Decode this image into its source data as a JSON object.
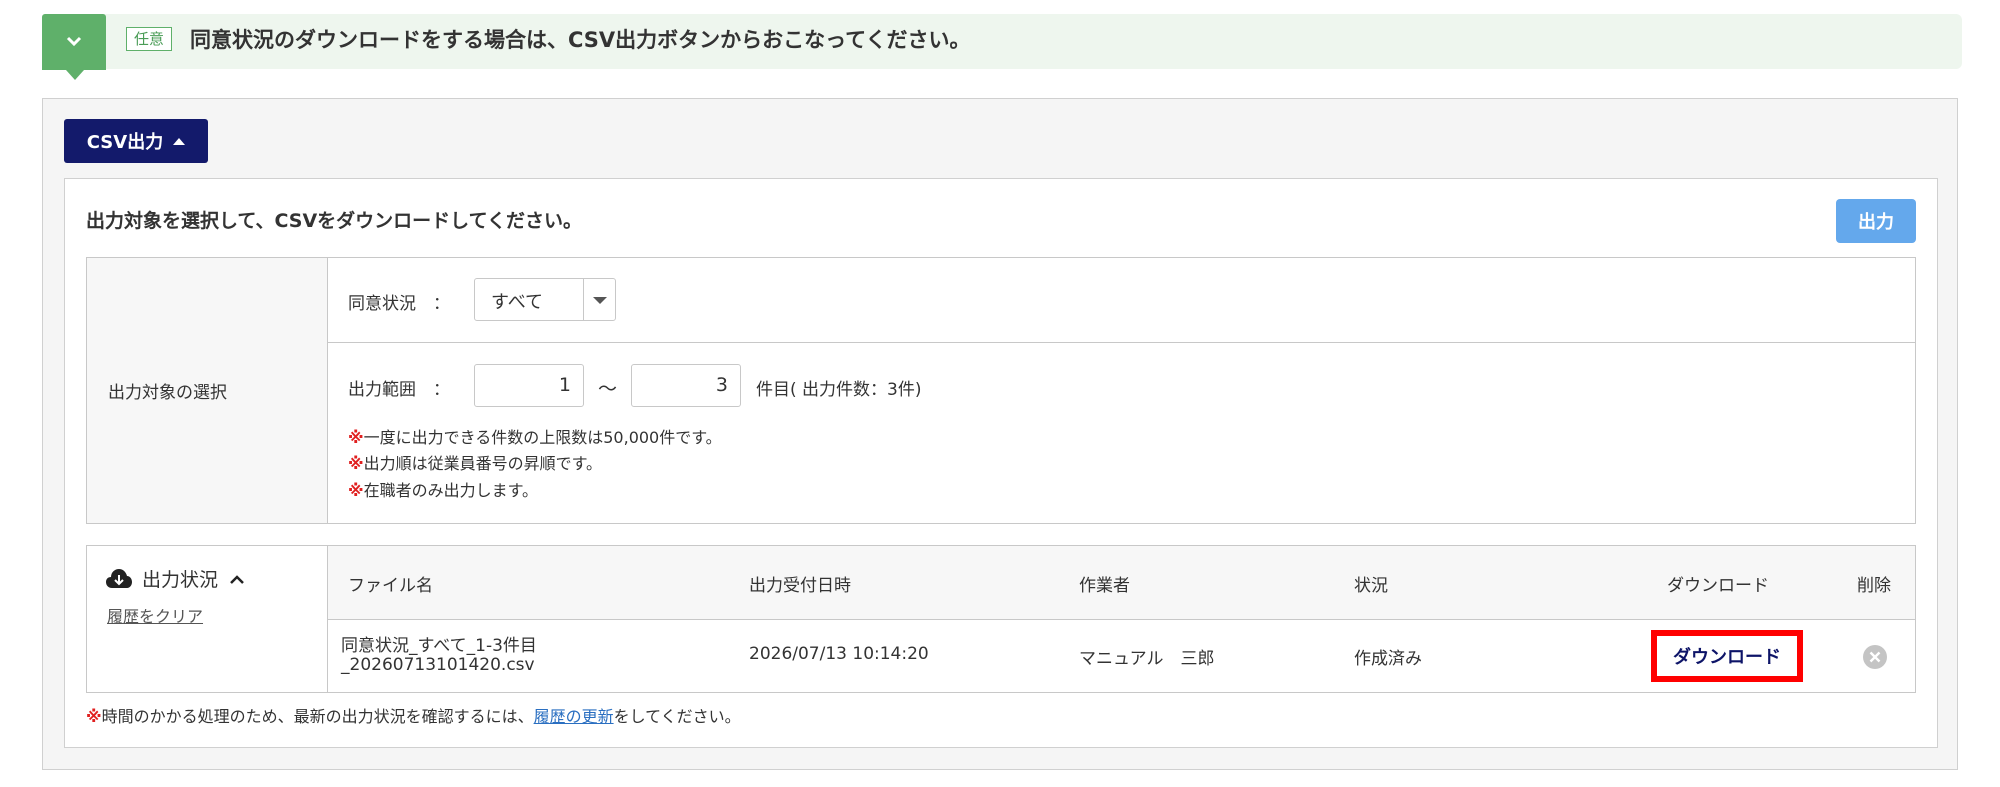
{
  "banner": {
    "badge": "任意",
    "text": "同意状況のダウンロードをする場合は、CSV出力ボタンからおこなってください。"
  },
  "csv_toggle": {
    "label": "CSV出力"
  },
  "panel": {
    "heading": "出力対象を選択して、CSVをダウンロードしてください。",
    "output_button": "出力"
  },
  "selection": {
    "section_label": "出力対象の選択",
    "consent_label": "同意状況　：",
    "consent_value": "すべて",
    "range_label": "出力範囲　：",
    "range_from": "1",
    "range_sep": "～",
    "range_to": "3",
    "range_suffix": "件目( 出力件数：3件)",
    "note_mark": "※",
    "notes": [
      "一度に出力できる件数の上限数は50,000件です。",
      "出力順は従業員番号の昇順です。",
      "在職者のみ出力します。"
    ]
  },
  "status": {
    "title": "出力状況",
    "clear_link": "履歴をクリア",
    "columns": [
      "ファイル名",
      "出力受付日時",
      "作業者",
      "状況",
      "ダウンロード",
      "削除"
    ],
    "rows": [
      {
        "file_line1": "同意状況_すべて_1-3件目",
        "file_line2": "_20260713101420.csv",
        "received_at": "2026/07/13 10:14:20",
        "worker": "マニュアル　三郎",
        "state": "作成済み",
        "download_label": "ダウンロード"
      }
    ]
  },
  "footer_note": {
    "mark": "※",
    "before": "時間のかかる処理のため、最新の出力状況を確認するには、",
    "link": "履歴の更新",
    "after": "をしてください。"
  },
  "colors": {
    "banner_bg": "#eef6ee",
    "green": "#5fb06a",
    "navy": "#131a6b",
    "output_blue": "#64a8ec",
    "highlight_red": "#ff0000"
  }
}
